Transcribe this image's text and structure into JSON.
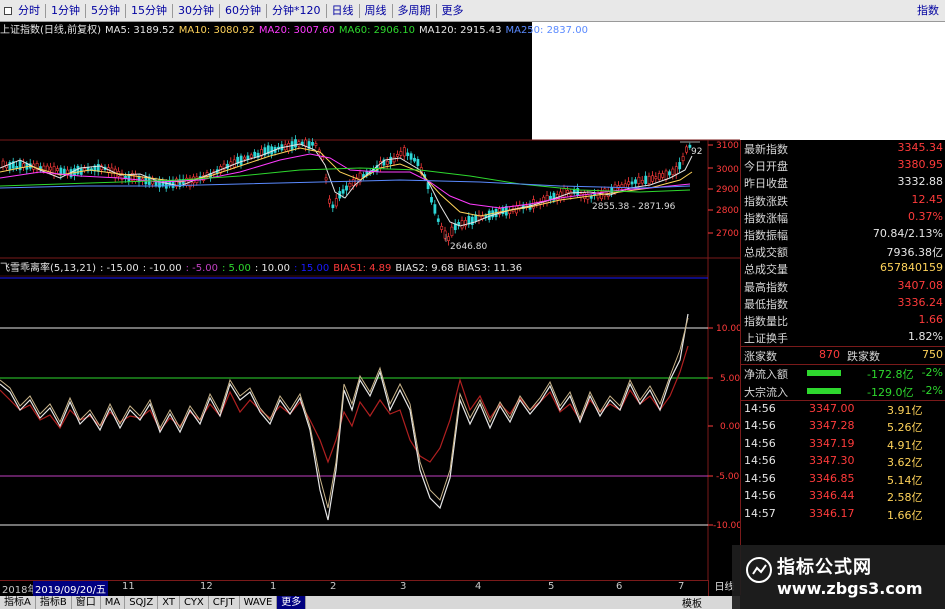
{
  "toolbar": {
    "items": [
      "分时",
      "1分钟",
      "5分钟",
      "15分钟",
      "30分钟",
      "60分钟",
      "分钟*120",
      "日线",
      "周线",
      "多周期",
      "更多"
    ],
    "right_label": "指数"
  },
  "ma_line": {
    "name": "上证指数(日线,前复权)",
    "ma5": "MA5: 3189.52",
    "ma10": "MA10: 3080.92",
    "ma20": "MA20: 3007.60",
    "ma60": "MA60: 2906.10",
    "ma120": "MA120: 2915.43",
    "ma250": "MA250: 2837.00"
  },
  "price_axis": [
    "3100",
    "3000",
    "2900",
    "2800",
    "2700"
  ],
  "price_annotations": {
    "low1": "2646.80",
    "range": "2855.38 - 2871.96",
    "high_partial": "92"
  },
  "indicator_line": {
    "name": "飞雪乖离率(5,13,21)",
    "levels": ": -15.00 : -10.00 : -5.00 : 5.00 : 10.00 : 15.00",
    "level_minus15": ": -15.00",
    "level_minus10": ": -10.00",
    "level_minus5": ": -5.00",
    "level_5": ": 5.00",
    "level_10": ": 10.00",
    "level_15": ": 15.00",
    "bias1": "BIAS1: 4.89",
    "bias2": "BIAS2: 9.68",
    "bias3": "BIAS3: 11.36"
  },
  "indicator_axis": [
    "10.00",
    "5.00",
    "0.00",
    "-5.00",
    "-10.00"
  ],
  "colors": {
    "up": "#ff3b3b",
    "down": "#2ed8d8",
    "ma5": "#e6e6e6",
    "ma10": "#ffd35a",
    "ma20": "#ff3bff",
    "ma60": "#2ed82e",
    "ma120": "#5a8aff",
    "grid": "#7a1a1a"
  },
  "quote": [
    {
      "label": "最新指数",
      "value": "3345.34",
      "color": "red"
    },
    {
      "label": "今日开盘",
      "value": "3380.95",
      "color": "red"
    },
    {
      "label": "昨日收盘",
      "value": "3332.88",
      "color": "white"
    },
    {
      "label": "指数涨跌",
      "value": "12.45",
      "color": "red"
    },
    {
      "label": "指数涨幅",
      "value": "0.37%",
      "color": "red"
    },
    {
      "label": "指数振幅",
      "value": "70.84/2.13%",
      "color": "white"
    },
    {
      "label": "总成交额",
      "value": "7936.38亿",
      "color": "white"
    },
    {
      "label": "总成交量",
      "value": "657840159",
      "color": "yellow"
    },
    {
      "label": "最高指数",
      "value": "3407.08",
      "color": "red"
    },
    {
      "label": "最低指数",
      "value": "3336.24",
      "color": "red"
    },
    {
      "label": "指数量比",
      "value": "1.66",
      "color": "red"
    },
    {
      "label": "上证换手",
      "value": "1.82%",
      "color": "white"
    }
  ],
  "breadth": {
    "up_label": "涨家数",
    "up_value": "870",
    "down_label": "跌家数",
    "down_value": "750"
  },
  "flows": [
    {
      "label": "净流入额",
      "value": "-172.8亿",
      "pct": "-2%"
    },
    {
      "label": "大宗流入",
      "value": "-129.0亿",
      "pct": "-2%"
    }
  ],
  "ticks": [
    {
      "time": "14:56",
      "price": "3347.00",
      "vol": "3.91亿"
    },
    {
      "time": "14:56",
      "price": "3347.28",
      "vol": "5.26亿"
    },
    {
      "time": "14:56",
      "price": "3347.19",
      "vol": "4.91亿"
    },
    {
      "time": "14:56",
      "price": "3347.30",
      "vol": "3.62亿"
    },
    {
      "time": "14:56",
      "price": "3346.85",
      "vol": "5.14亿"
    },
    {
      "time": "14:56",
      "price": "3346.44",
      "vol": "2.58亿"
    },
    {
      "time": "14:57",
      "price": "3346.17",
      "vol": "1.66亿"
    }
  ],
  "date_axis": {
    "labels": [
      "2018年",
      "2019/09/20/五",
      "11",
      "12",
      "1",
      "2",
      "3",
      "4",
      "5",
      "6",
      "7"
    ],
    "period": "日线"
  },
  "tabs": [
    "指标A",
    "指标B",
    "窗口",
    "MA",
    "SQJZ",
    "XT",
    "CYX",
    "CFJT",
    "WAVE",
    "更多"
  ],
  "tab_extra": "模板",
  "watermark": {
    "title": "指标公式网",
    "url": "www.zbgs3.com"
  }
}
